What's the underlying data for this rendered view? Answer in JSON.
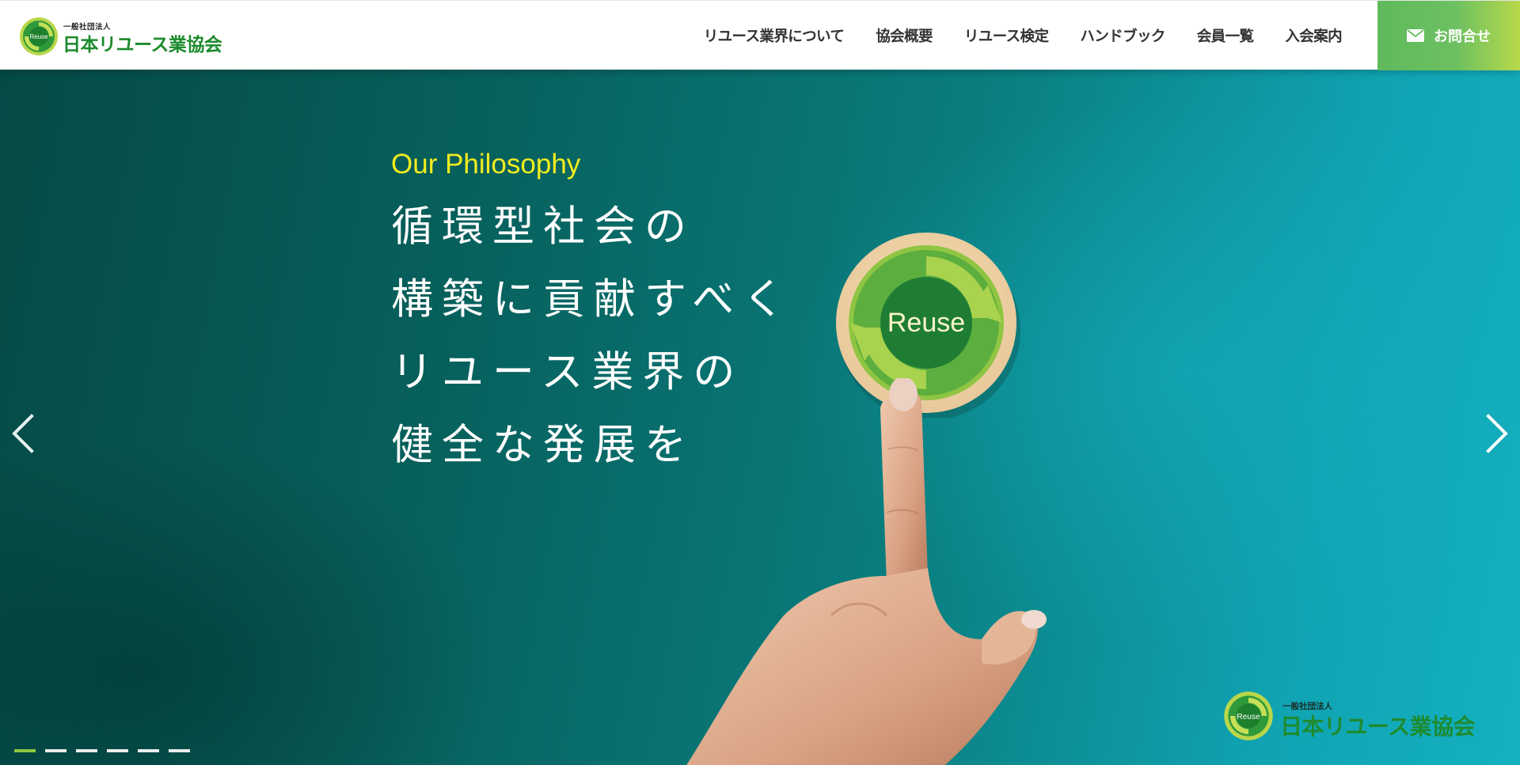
{
  "header": {
    "logo": {
      "small_text": "一般社団法人",
      "main_text": "日本リユース業協会",
      "mark_text": "Reuse"
    },
    "nav": [
      {
        "label": "リユース業界について"
      },
      {
        "label": "協会概要"
      },
      {
        "label": "リユース検定"
      },
      {
        "label": "ハンドブック"
      },
      {
        "label": "会員一覧"
      },
      {
        "label": "入会案内"
      }
    ],
    "contact": {
      "label": "お問合せ",
      "icon": "mail-icon"
    }
  },
  "hero": {
    "eyebrow": "Our Philosophy",
    "lines": [
      "循環型社会の",
      "構築に貢献すべく",
      "リユース業界の",
      "健全な発展を"
    ],
    "badge_text": "Reuse",
    "corner_logo": {
      "small_text": "一般社団法人",
      "main_text": "日本リユース業協会",
      "mark_text": "Reuse"
    },
    "prev_icon": "chevron-left-icon",
    "next_icon": "chevron-right-icon",
    "slides_total": 6,
    "slide_active": 1
  },
  "colors": {
    "brand_green": "#1c8a2c",
    "accent_yellow": "#f2ec1f",
    "contact_gradient_start": "#5fba5c",
    "contact_gradient_end": "#b8d94a",
    "hero_teal_dark": "#054a45",
    "hero_teal_light": "#14b0c1",
    "dot_active": "#8dc63f"
  }
}
